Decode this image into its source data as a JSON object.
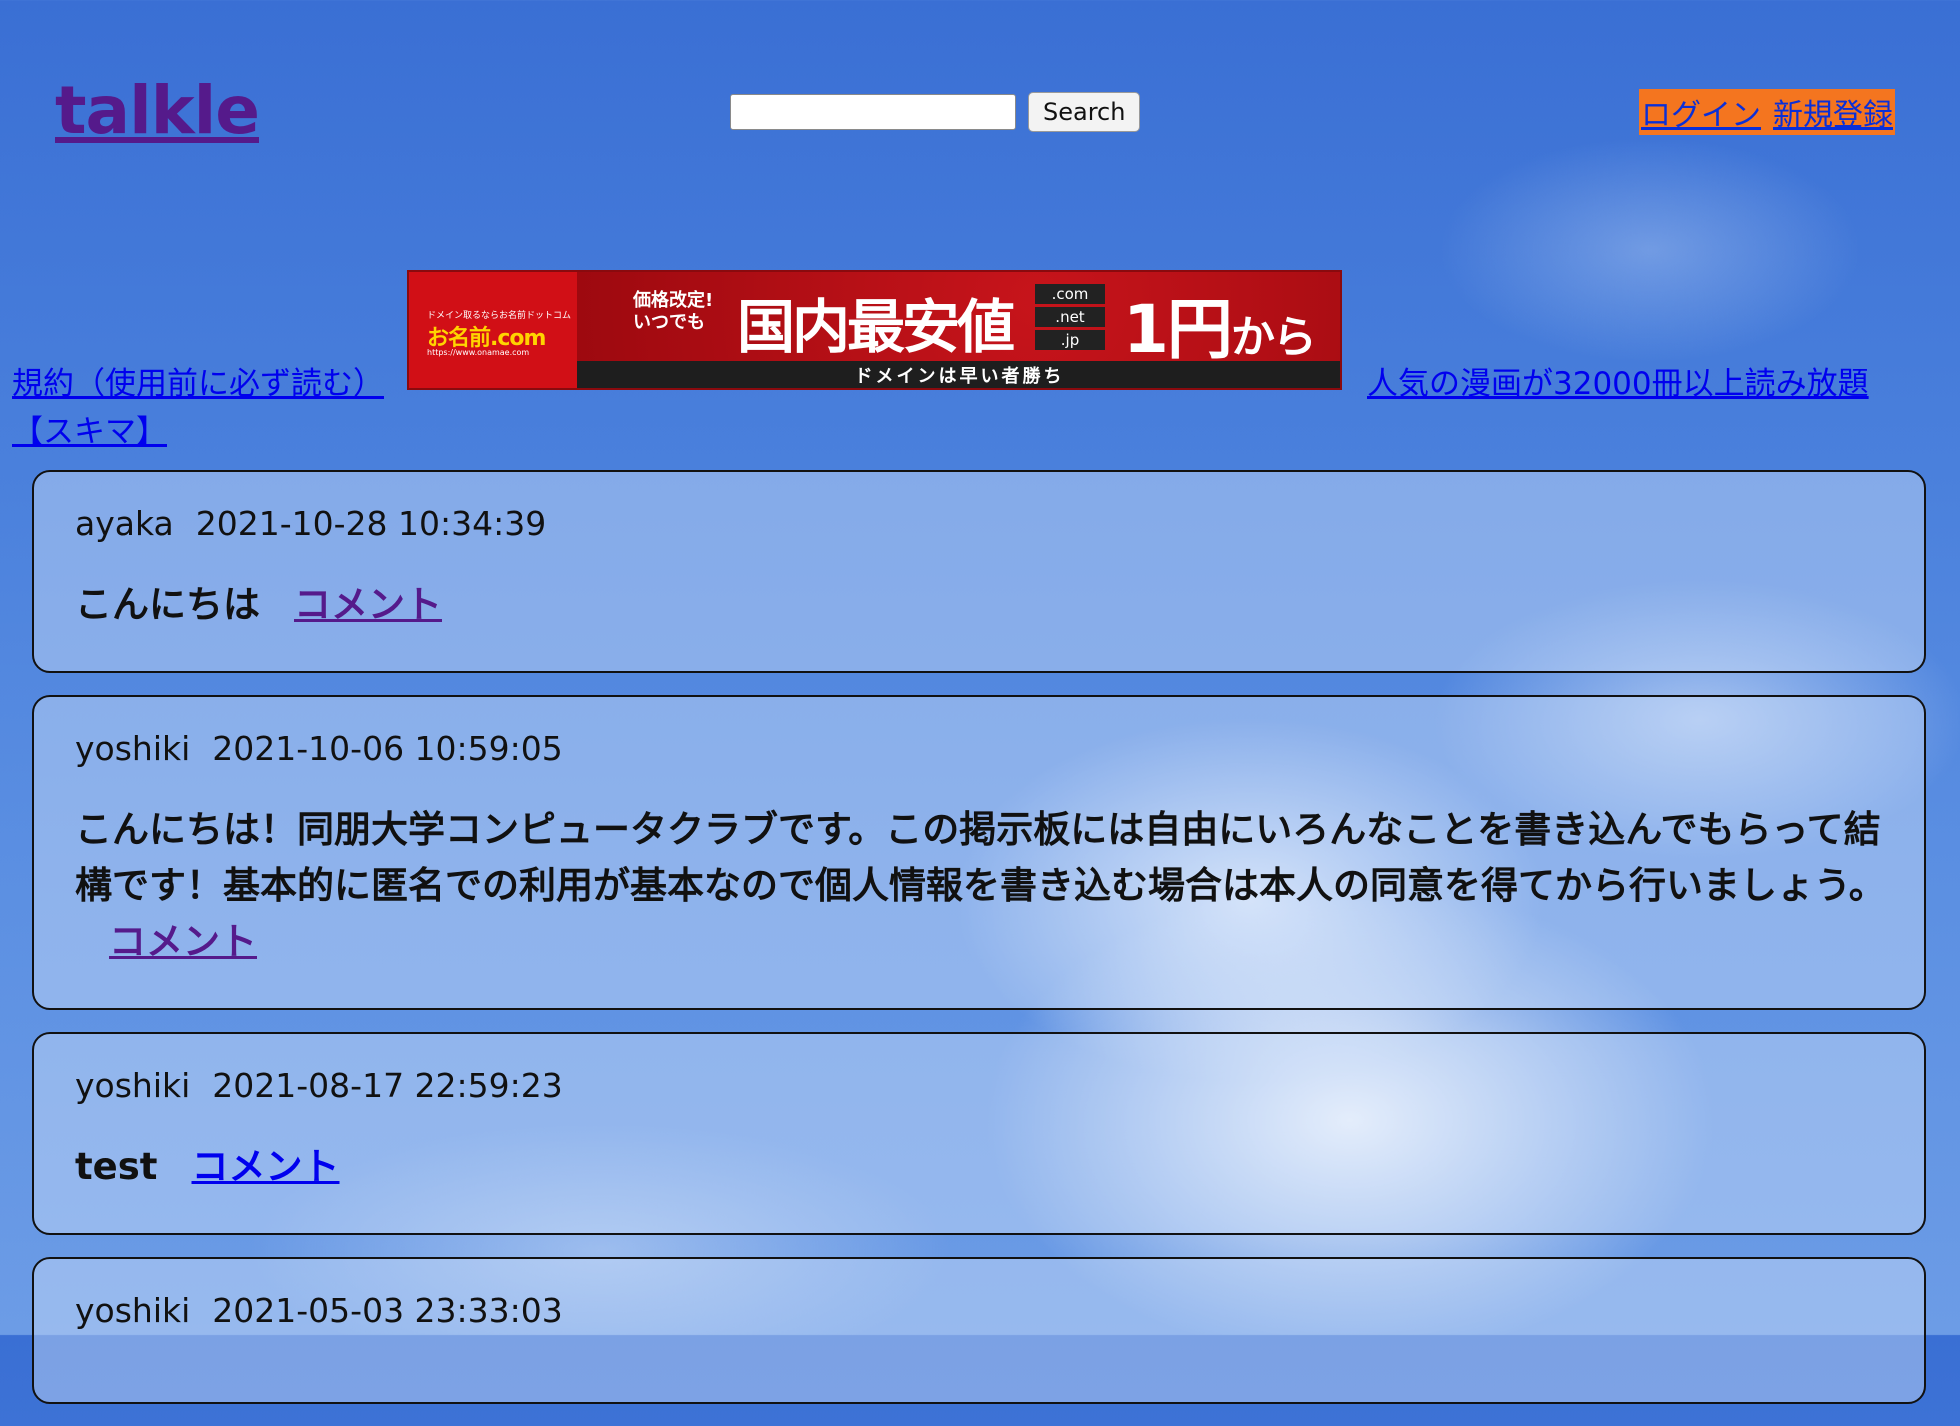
{
  "header": {
    "logo": "talkle",
    "search": {
      "value": "",
      "placeholder": "",
      "button_label": "Search"
    },
    "auth": {
      "login_label": "ログイン",
      "register_label": "新規登録"
    }
  },
  "links": {
    "terms": "規約（使用前に必ず読む）",
    "manga": "人気の漫画が32000冊以上読み放題",
    "sukima": "【スキマ】"
  },
  "banner": {
    "small_text": "ドメイン取るならお名前ドットコム",
    "brand": "お名前.com",
    "url_text": "https://www.onamae.com",
    "line1a": "価格改定!",
    "line1b": "いつでも",
    "headline": "国内最安値",
    "tlds": [
      ".com",
      ".net",
      ".jp"
    ],
    "price": "1円",
    "price_suffix": "から",
    "tagline": "ドメインは早い者勝ち"
  },
  "posts": [
    {
      "author": "ayaka",
      "timestamp": "2021-10-28 10:34:39",
      "body": "こんにちは",
      "comment_label": "コメント"
    },
    {
      "author": "yoshiki",
      "timestamp": "2021-10-06 10:59:05",
      "body": "こんにちは！同朋大学コンピュータクラブです。この掲示板には自由にいろんなことを書き込んでもらって結構です！基本的に匿名での利用が基本なので個人情報を書き込む場合は本人の同意を得てから行いましょう。",
      "comment_label": "コメント"
    },
    {
      "author": "yoshiki",
      "timestamp": "2021-08-17 22:59:23",
      "body": "test",
      "comment_label": "コメント"
    },
    {
      "author": "yoshiki",
      "timestamp": "2021-05-03 23:33:03",
      "body": "",
      "comment_label": ""
    }
  ]
}
